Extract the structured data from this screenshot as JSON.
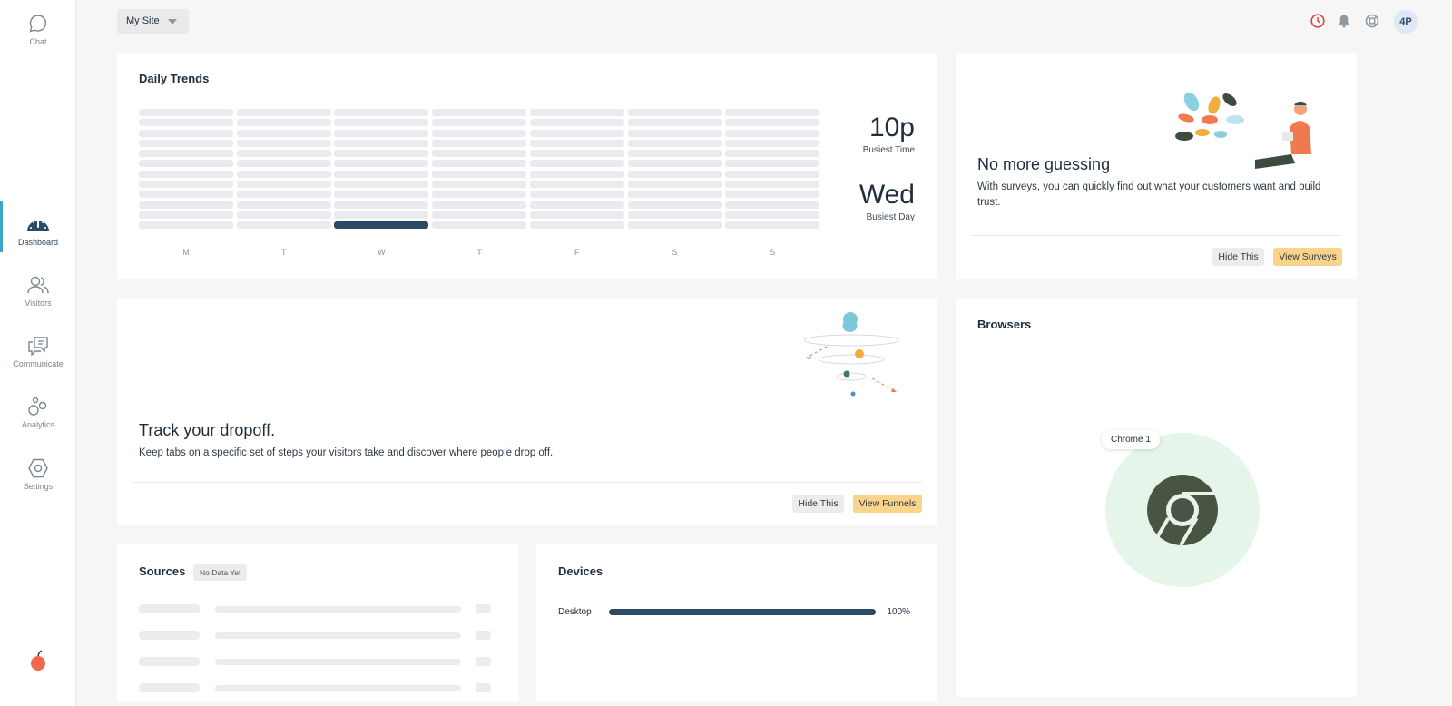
{
  "sidebar": {
    "items": [
      {
        "label": "Chat",
        "icon": "chat-bubble-icon"
      },
      {
        "label": "Dashboard",
        "icon": "dashboard-gauge-icon"
      },
      {
        "label": "Visitors",
        "icon": "visitors-icon"
      },
      {
        "label": "Communicate",
        "icon": "communicate-icon"
      },
      {
        "label": "Analytics",
        "icon": "analytics-icon"
      },
      {
        "label": "Settings",
        "icon": "settings-hexagon-icon"
      }
    ],
    "active": "Dashboard",
    "logo": "peach-logo-icon"
  },
  "topbar": {
    "site_select": "My Site",
    "icons": [
      "clock-icon",
      "bell-icon",
      "help-lifebuoy-icon"
    ],
    "avatar": "4P"
  },
  "daily_trends": {
    "title": "Daily Trends",
    "days": [
      "M",
      "T",
      "W",
      "T",
      "F",
      "S",
      "S"
    ],
    "busiest_day_index": 2,
    "busiest_time_value": "10p",
    "busiest_time_label": "Busiest Time",
    "busiest_day_value": "Wed",
    "busiest_day_label": "Busiest Day"
  },
  "surveys_promo": {
    "title": "No more guessing",
    "text": "With surveys, you can quickly find out what your customers want and build trust.",
    "hide_label": "Hide This",
    "action_label": "View Surveys"
  },
  "funnels_promo": {
    "title": "Track your dropoff.",
    "text": "Keep tabs on a specific set of steps your visitors take and discover where people drop off.",
    "hide_label": "Hide This",
    "action_label": "View Funnels"
  },
  "browsers": {
    "title": "Browsers",
    "items": [
      {
        "name": "Chrome",
        "count": "1",
        "label": "Chrome 1"
      }
    ]
  },
  "sources": {
    "title": "Sources",
    "badge": "No Data Yet"
  },
  "devices": {
    "title": "Devices",
    "items": [
      {
        "name": "Desktop",
        "percent_label": "100%",
        "fraction": 1.0
      }
    ]
  },
  "colors": {
    "accent_dark": "#2d4a64",
    "accent_yellow": "#fad48a",
    "active_indicator": "#3aa7c9",
    "chrome_bg": "#e6f5e9",
    "chrome_icon": "#4a5442"
  }
}
